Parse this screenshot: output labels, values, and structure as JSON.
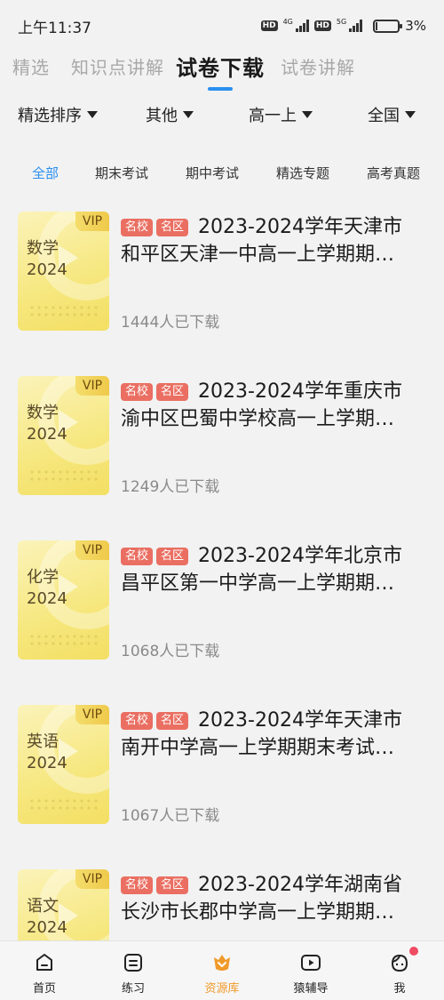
{
  "status_bar": {
    "time": "上午11:37",
    "hd1": "HD",
    "net1": "4G",
    "hd2": "HD",
    "net2": "5G",
    "battery": "3%"
  },
  "top_tabs": [
    "精选",
    "知识点讲解",
    "试卷下载",
    "试卷讲解"
  ],
  "active_top_tab": "试卷下载",
  "filters": [
    "精选排序",
    "其他",
    "高一上",
    "全国"
  ],
  "categories": [
    "全部",
    "期末考试",
    "期中考试",
    "精选专题",
    "高考真题"
  ],
  "active_category": "全部",
  "items": [
    {
      "subject": "数学",
      "year": "2024",
      "vip": "VIP",
      "tag1": "名校",
      "tag2": "名区",
      "title_line1": "2023-2024学年天津市",
      "title_line2": "和平区天津一中高一上学期期末考试",
      "downloads": "1444人已下载"
    },
    {
      "subject": "数学",
      "year": "2024",
      "vip": "VIP",
      "tag1": "名校",
      "tag2": "名区",
      "title_line1": "2023-2024学年重庆市",
      "title_line2": "渝中区巴蜀中学校高一上学期期末考试",
      "downloads": "1249人已下载"
    },
    {
      "subject": "化学",
      "year": "2024",
      "vip": "VIP",
      "tag1": "名校",
      "tag2": "名区",
      "title_line1": "2023-2024学年北京市",
      "title_line2": "昌平区第一中学高一上学期期末考试",
      "downloads": "1068人已下载"
    },
    {
      "subject": "英语",
      "year": "2024",
      "vip": "VIP",
      "tag1": "名校",
      "tag2": "名区",
      "title_line1": "2023-2024学年天津市",
      "title_line2": "南开中学高一上学期期末考试试卷",
      "downloads": "1067人已下载"
    },
    {
      "subject": "语文",
      "year": "2024",
      "vip": "VIP",
      "tag1": "名校",
      "tag2": "名区",
      "title_line1": "2023-2024学年湖南省",
      "title_line2": "长沙市长郡中学高一上学期期末考试",
      "downloads": ""
    }
  ],
  "bottom_nav": [
    {
      "label": "首页",
      "icon": "home-icon"
    },
    {
      "label": "练习",
      "icon": "practice-icon"
    },
    {
      "label": "资源库",
      "icon": "resource-library-icon"
    },
    {
      "label": "猿辅导",
      "icon": "video-play-icon"
    },
    {
      "label": "我",
      "icon": "profile-face-icon"
    }
  ],
  "active_nav": "资源库",
  "colors": {
    "accent_blue": "#2a8ff0",
    "tag_red": "#ea6f62",
    "active_nav": "#f09a2a",
    "cover_yellow": "#f6e77e"
  }
}
